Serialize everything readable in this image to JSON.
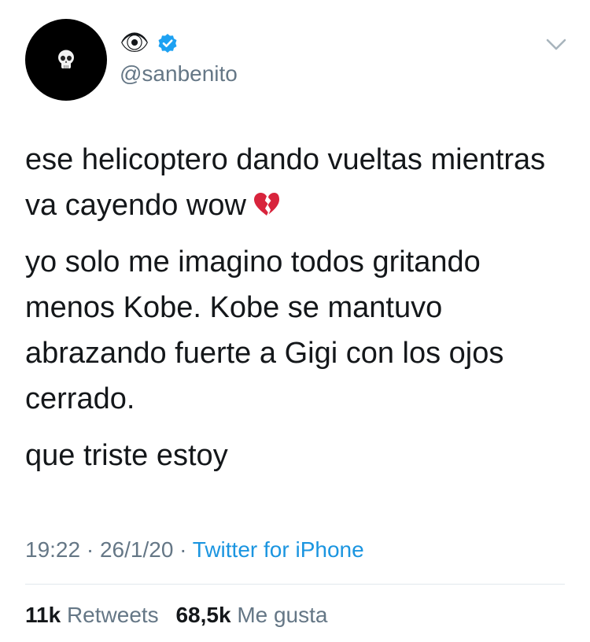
{
  "author": {
    "display_name": "👁",
    "handle": "@sanbenito",
    "verified": true,
    "avatar_icon": "skull-icon"
  },
  "tweet": {
    "paragraphs": [
      "ese helicoptero dando vueltas mientras va cayendo wow",
      "yo solo me imagino todos gritando menos Kobe. Kobe se mantuvo abrazando fuerte a Gigi con los ojos cerrado.",
      "que triste estoy"
    ],
    "emoji": "broken-heart-icon"
  },
  "meta": {
    "time": "19:22",
    "separator": "·",
    "date": "26/1/20",
    "source": "Twitter for iPhone"
  },
  "stats": {
    "retweets_count": "11k",
    "retweets_label": "Retweets",
    "likes_count": "68,5k",
    "likes_label": "Me gusta"
  },
  "colors": {
    "text": "#14171a",
    "secondary": "#657786",
    "link": "#1b95e0",
    "verified": "#1da1f2",
    "divider": "#e1e8ed"
  }
}
